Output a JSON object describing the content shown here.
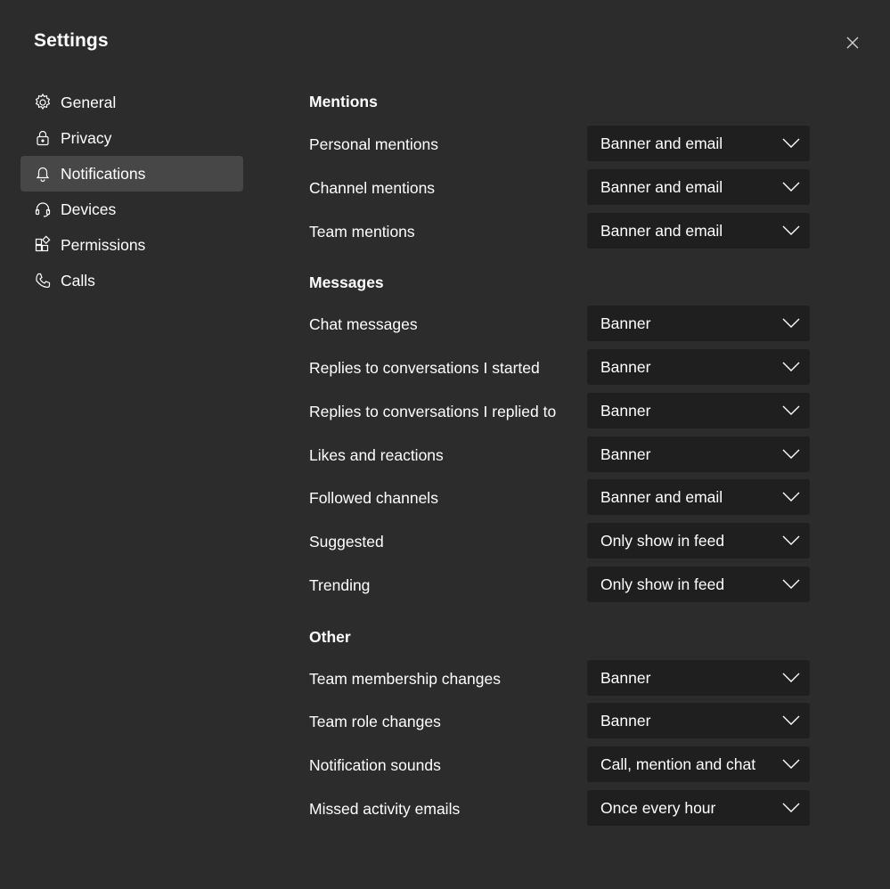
{
  "window": {
    "title": "Settings",
    "close_icon": "close-icon"
  },
  "sidebar": {
    "items": [
      {
        "label": "General",
        "icon": "gear-icon",
        "active": false
      },
      {
        "label": "Privacy",
        "icon": "lock-icon",
        "active": false
      },
      {
        "label": "Notifications",
        "icon": "bell-icon",
        "active": true
      },
      {
        "label": "Devices",
        "icon": "headset-icon",
        "active": false
      },
      {
        "label": "Permissions",
        "icon": "apps-icon",
        "active": false
      },
      {
        "label": "Calls",
        "icon": "phone-icon",
        "active": false
      }
    ]
  },
  "sections": {
    "mentions": {
      "title": "Mentions",
      "rows": [
        {
          "label": "Personal mentions",
          "value": "Banner and email"
        },
        {
          "label": "Channel mentions",
          "value": "Banner and email"
        },
        {
          "label": "Team mentions",
          "value": "Banner and email"
        }
      ]
    },
    "messages": {
      "title": "Messages",
      "rows": [
        {
          "label": "Chat messages",
          "value": "Banner"
        },
        {
          "label": "Replies to conversations I started",
          "value": "Banner"
        },
        {
          "label": "Replies to conversations I replied to",
          "value": "Banner"
        },
        {
          "label": "Likes and reactions",
          "value": "Banner"
        },
        {
          "label": "Followed channels",
          "value": "Banner and email"
        },
        {
          "label": "Suggested",
          "value": "Only show in feed"
        },
        {
          "label": "Trending",
          "value": "Only show in feed"
        }
      ]
    },
    "other": {
      "title": "Other",
      "rows": [
        {
          "label": "Team membership changes",
          "value": "Banner"
        },
        {
          "label": "Team role changes",
          "value": "Banner"
        },
        {
          "label": "Notification sounds",
          "value": "Call, mention and chat"
        },
        {
          "label": "Missed activity emails",
          "value": "Once every hour"
        }
      ]
    }
  },
  "colors": {
    "background": "#2d2c2c",
    "active_nav": "#484747",
    "dropdown": "#1f1f1f",
    "text": "#ffffff"
  }
}
